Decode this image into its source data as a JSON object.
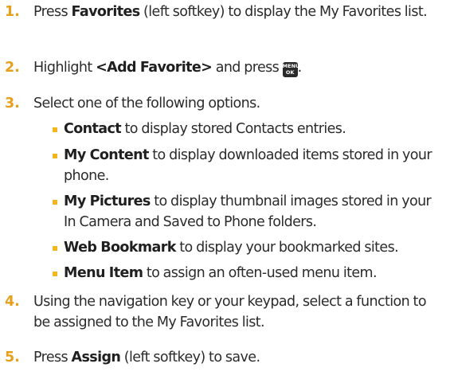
{
  "steps": [
    {
      "num": "1.",
      "bold": "Favorites",
      "pre": "Press ",
      "post": " (left softkey) to display the My Favorites list."
    },
    {
      "num": "2.",
      "pre": "Highlight ",
      "bold": "<Add Favorite>",
      "post": " and press "
    },
    {
      "num": "3.",
      "text": "Select one of the following options."
    },
    {
      "num": "4.",
      "text": "Using the navigation key or your keypad, select a function to be assigned to the My Favorites list."
    },
    {
      "num": "5.",
      "pre": "Press ",
      "bold": "Assign",
      "post": " (left softkey) to save."
    }
  ],
  "key_icon": {
    "top": "MENU",
    "bottom": "OK",
    "icon": "menu-ok-key-icon"
  },
  "options": [
    {
      "bold": "Contact",
      "text": " to display stored Contacts entries."
    },
    {
      "bold": "My Content",
      "text": " to display downloaded items stored in your phone."
    },
    {
      "bold": "My Pictures",
      "text": " to display thumbnail images stored in your In Camera and Saved to Phone folders."
    },
    {
      "bold": "Web Bookmark",
      "text": " to display your bookmarked sites."
    },
    {
      "bold": "Menu Item",
      "text": " to assign an often-used menu item."
    }
  ],
  "colors": {
    "number": "#e8a01c",
    "bullet": "#f3b61f",
    "text": "#2b2b2b"
  }
}
